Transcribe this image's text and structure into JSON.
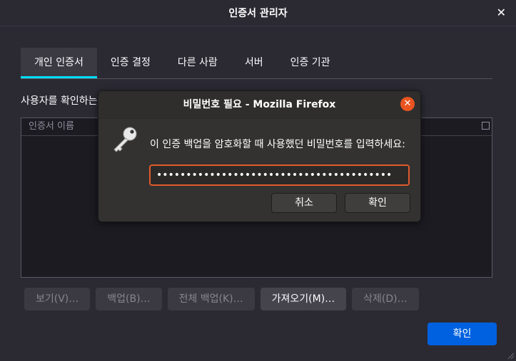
{
  "window": {
    "title": "인증서 관리자"
  },
  "tabs": [
    {
      "label": "개인 인증서"
    },
    {
      "label": "인증 결정"
    },
    {
      "label": "다른 사람"
    },
    {
      "label": "서버"
    },
    {
      "label": "인증 기관"
    }
  ],
  "main": {
    "description": "사용자를 확인하는",
    "column_header": "인증서 이름",
    "ok_label": "확인"
  },
  "buttons": {
    "view": "보기(V)…",
    "backup": "백업(B)…",
    "backup_all": "전체 백업(K)…",
    "import": "가져오기(M)…",
    "delete": "삭제(D)…"
  },
  "modal": {
    "title": "비밀번호 필요 - Mozilla Firefox",
    "prompt": "이 인증 백업을 암호화할 때 사용했던 비밀번호를 입력하세요:",
    "password_value": "••••••••••••••••••••••••••••••••••••••••",
    "cancel_label": "취소",
    "ok_label": "확인"
  },
  "colors": {
    "accent_tab": "#00ddff",
    "primary_button": "#0061e0",
    "modal_close": "#e95420",
    "input_focus_border": "#e05a2c"
  },
  "icons": {
    "close": "close-icon",
    "key": "key-icon",
    "column_picker": "column-picker-icon",
    "resize": "resize-grip-icon"
  }
}
